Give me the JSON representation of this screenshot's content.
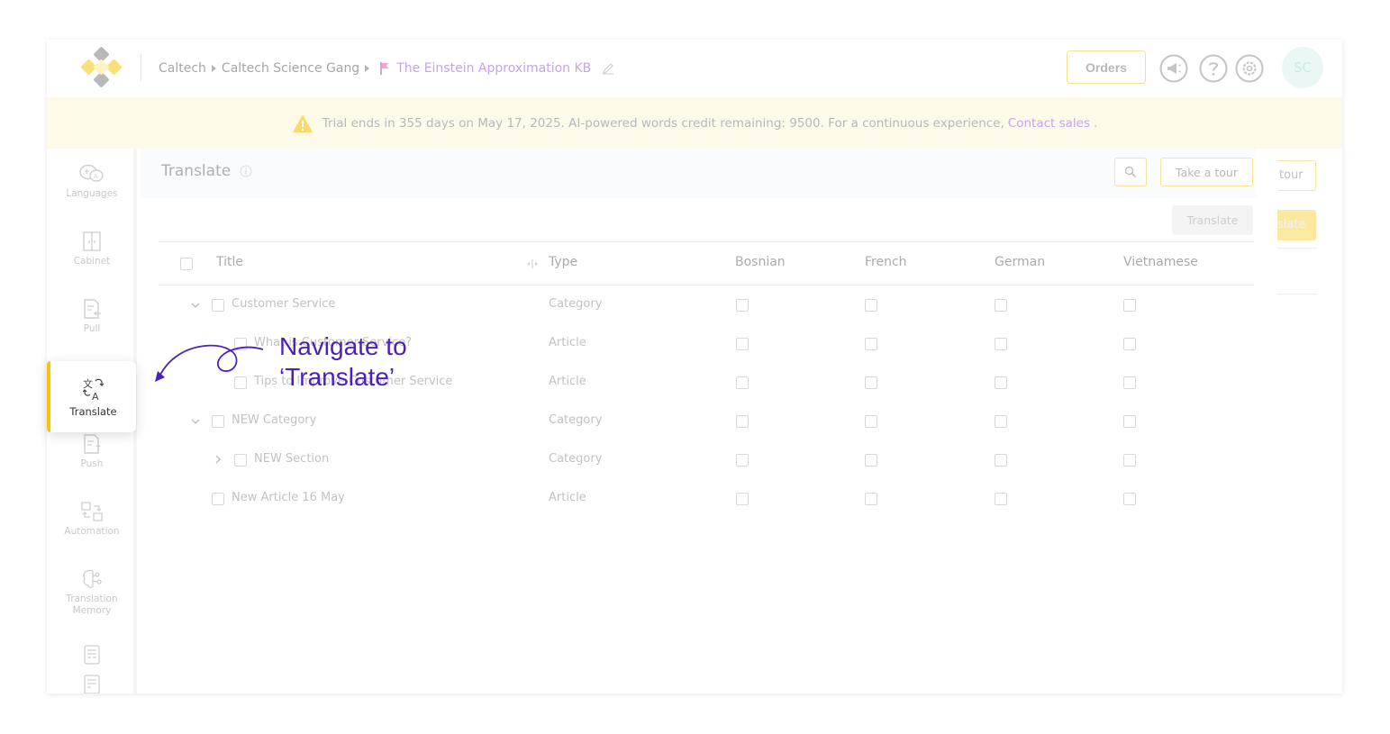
{
  "header": {
    "breadcrumb": [
      "Caltech",
      "Caltech Science Gang"
    ],
    "kb_name": "The Einstein Approximation KB",
    "orders_label": "Orders",
    "avatar_initials": "SC"
  },
  "banner": {
    "text": "Trial ends in 355 days on May 17, 2025. AI-powered words credit remaining: 9500. For a continuous experience,",
    "link": "Contact sales",
    "suffix": "."
  },
  "sidebar": {
    "items": [
      {
        "label": "Languages",
        "icon": "languages-icon"
      },
      {
        "label": "Cabinet",
        "icon": "cabinet-icon"
      },
      {
        "label": "Pull",
        "icon": "pull-icon"
      },
      {
        "label": "Translate",
        "icon": "translate-icon"
      },
      {
        "label": "Push",
        "icon": "push-icon"
      },
      {
        "label": "Automation",
        "icon": "automation-icon"
      },
      {
        "label": "Translation Memory",
        "icon": "translation-memory-icon"
      }
    ]
  },
  "page": {
    "title": "Translate",
    "take_tour_label": "Take a tour",
    "translate_button": "Translate",
    "ghost_tour": "tour",
    "ghost_translate": "slate"
  },
  "table": {
    "columns": [
      "Title",
      "Type",
      "Bosnian",
      "French",
      "German",
      "Vietnamese"
    ],
    "rows": [
      {
        "title": "Customer Service",
        "type": "Category"
      },
      {
        "title": "What is Customer Service?",
        "type": "Article"
      },
      {
        "title": "Tips to Improve Customer Service",
        "type": "Article"
      },
      {
        "title": "NEW Category",
        "type": "Category"
      },
      {
        "title": "NEW Section",
        "type": "Category"
      },
      {
        "title": "New Article 16 May",
        "type": "Article"
      }
    ]
  },
  "callout": {
    "line1": "Navigate to",
    "line2": "‘Translate’",
    "highlight_label": "Translate"
  },
  "colors": {
    "accent_yellow": "#f5c50b",
    "callout_purple": "#4a22b8",
    "link_purple": "#c4a6ea"
  }
}
